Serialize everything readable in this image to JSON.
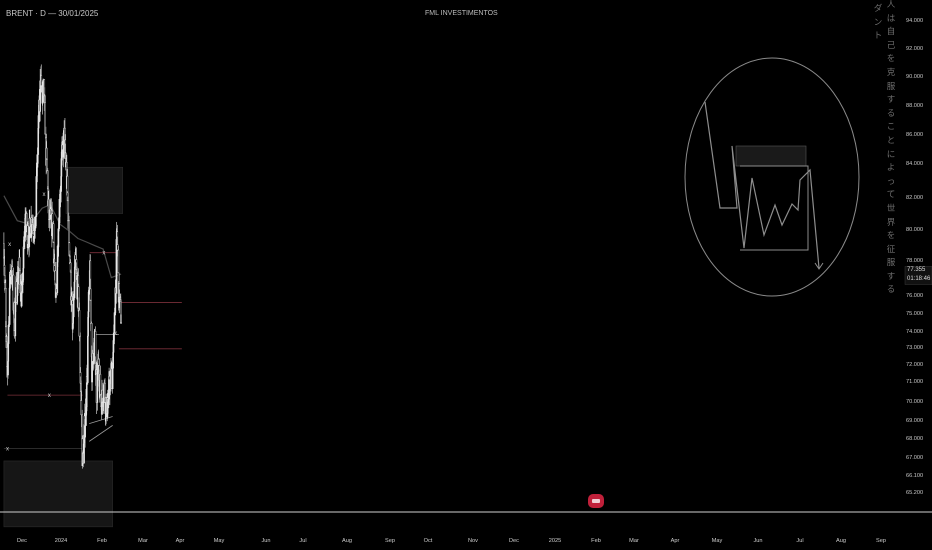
{
  "header": {
    "symbol_line": "BRENT · D  —  30/01/2025",
    "center_title": "FML INVESTIMENTOS"
  },
  "vertical_text": {
    "right_column": "人は自己を克服することによって世界を征服する",
    "left_column": "ダント"
  },
  "price_readout": {
    "last_price": "77.355",
    "countdown": "01:18:46"
  },
  "chart_data": {
    "type": "candlestick",
    "title": "",
    "xlabel": "",
    "ylabel": "",
    "ylim": [
      64.5,
      94.2
    ],
    "y_ticks": [
      "94.000",
      "92.000",
      "90.000",
      "88.000",
      "86.000",
      "84.000",
      "82.000",
      "80.000",
      "78.000",
      "77.355",
      "76.000",
      "75.000",
      "74.000",
      "73.000",
      "72.000",
      "71.000",
      "70.000",
      "69.000",
      "68.000",
      "67.000",
      "66.100",
      "65.200"
    ],
    "x_ticks": [
      "Dec",
      "2024",
      "Feb",
      "Mar",
      "Apr",
      "May",
      "Jun",
      "Jul",
      "Aug",
      "Sep",
      "Oct",
      "Nov",
      "Dec",
      "2025",
      "Feb",
      "Mar",
      "Apr",
      "May",
      "Jun",
      "Jul",
      "Aug",
      "Sep"
    ],
    "price_path": [
      [
        "2023-11-27",
        81.5
      ],
      [
        "2023-12-03",
        77.0
      ],
      [
        "2023-12-10",
        73.5
      ],
      [
        "2023-12-16",
        78.5
      ],
      [
        "2023-12-24",
        80.5
      ],
      [
        "2024-01-05",
        77.0
      ],
      [
        "2024-01-12",
        79.0
      ],
      [
        "2024-01-22",
        80.3
      ],
      [
        "2024-02-01",
        78.2
      ],
      [
        "2024-02-12",
        82.8
      ],
      [
        "2024-02-25",
        81.8
      ],
      [
        "2024-03-08",
        83.0
      ],
      [
        "2024-03-20",
        82.2
      ],
      [
        "2024-03-30",
        87.0
      ],
      [
        "2024-04-10",
        91.0
      ],
      [
        "2024-04-16",
        89.5
      ],
      [
        "2024-04-21",
        90.5
      ],
      [
        "2024-04-30",
        86.5
      ],
      [
        "2024-05-10",
        83.0
      ],
      [
        "2024-05-25",
        82.5
      ],
      [
        "2024-06-04",
        78.0
      ],
      [
        "2024-06-14",
        82.5
      ],
      [
        "2024-06-25",
        86.0
      ],
      [
        "2024-07-05",
        87.5
      ],
      [
        "2024-07-15",
        85.0
      ],
      [
        "2024-07-25",
        81.0
      ],
      [
        "2024-08-05",
        76.5
      ],
      [
        "2024-08-15",
        80.5
      ],
      [
        "2024-08-28",
        78.0
      ],
      [
        "2024-09-05",
        72.5
      ],
      [
        "2024-09-11",
        69.2
      ],
      [
        "2024-09-25",
        73.0
      ],
      [
        "2024-10-07",
        80.5
      ],
      [
        "2024-10-15",
        74.5
      ],
      [
        "2024-10-25",
        76.0
      ],
      [
        "2024-11-01",
        73.0
      ],
      [
        "2024-11-08",
        75.0
      ],
      [
        "2024-11-18",
        72.5
      ],
      [
        "2024-11-28",
        73.5
      ],
      [
        "2024-12-08",
        72.0
      ],
      [
        "2024-12-18",
        73.5
      ],
      [
        "2024-12-28",
        74.2
      ],
      [
        "2025-01-05",
        76.5
      ],
      [
        "2025-01-10",
        79.5
      ],
      [
        "2025-01-15",
        82.0
      ],
      [
        "2025-01-22",
        78.5
      ],
      [
        "2025-01-30",
        77.4
      ]
    ],
    "moving_average": [
      [
        "2023-11-27",
        84.2
      ],
      [
        "2024-01-15",
        82.8
      ],
      [
        "2024-03-01",
        82.6
      ],
      [
        "2024-04-15",
        83.5
      ],
      [
        "2024-05-15",
        83.7
      ],
      [
        "2024-06-20",
        82.6
      ],
      [
        "2024-07-25",
        82.2
      ],
      [
        "2024-08-25",
        81.8
      ],
      [
        "2024-09-25",
        81.6
      ],
      [
        "2024-10-25",
        81.4
      ],
      [
        "2024-11-25",
        81.2
      ],
      [
        "2024-12-25",
        79.6
      ],
      [
        "2025-01-30",
        79.8
      ]
    ],
    "annotations": {
      "x_markers": [
        [
          "2023-12-18",
          81.5
        ],
        [
          "2024-04-22",
          84.3
        ],
        [
          "2024-05-12",
          73.0
        ],
        [
          "2023-12-10",
          70.0
        ],
        [
          "2024-11-28",
          81.0
        ],
        [
          "2025-01-10",
          76.5
        ]
      ],
      "horizontal_lines": [
        {
          "from": "2023-12-10",
          "to": "2024-09-11",
          "y": 73.0,
          "color": "#7a2f3a"
        },
        {
          "from": "2023-11-27",
          "to": "2024-09-11",
          "y": 70.0,
          "color": "#3a3a3a"
        },
        {
          "from": "2024-10-07",
          "to": "2025-01-15",
          "y": 81.0,
          "color": "#7a2f3a"
        },
        {
          "from": "2025-01-22",
          "to": "2025-09-10",
          "y": 78.2,
          "color": "#7a2f3a"
        },
        {
          "from": "2025-01-22",
          "to": "2025-09-10",
          "y": 75.6,
          "color": "#7a2f3a"
        },
        {
          "from": "2024-10-25",
          "to": "2025-01-22",
          "y": 76.4,
          "color": "#888888"
        }
      ],
      "zones": [
        {
          "from": "2024-07-12",
          "to": "2025-02-05",
          "y_top": 85.8,
          "y_bottom": 83.2
        },
        {
          "from": "2023-11-27",
          "to": "2024-12-30",
          "y_top": 69.3,
          "y_bottom": 65.6
        }
      ],
      "channel": [
        {
          "x1": "2024-10-05",
          "y1": 70.4,
          "x2": "2024-12-30",
          "y2": 71.3
        },
        {
          "x1": "2024-10-05",
          "y1": 71.4,
          "x2": "2024-12-30",
          "y2": 71.8
        }
      ]
    },
    "grid": false,
    "legend": "none"
  },
  "colors": {
    "background": "#000000",
    "candle": "#e8e8e8",
    "ma_line": "#4a4a4a",
    "level_red": "#7a2f3a",
    "zone_fill": "#161616",
    "price_tag": "#c0203a"
  }
}
